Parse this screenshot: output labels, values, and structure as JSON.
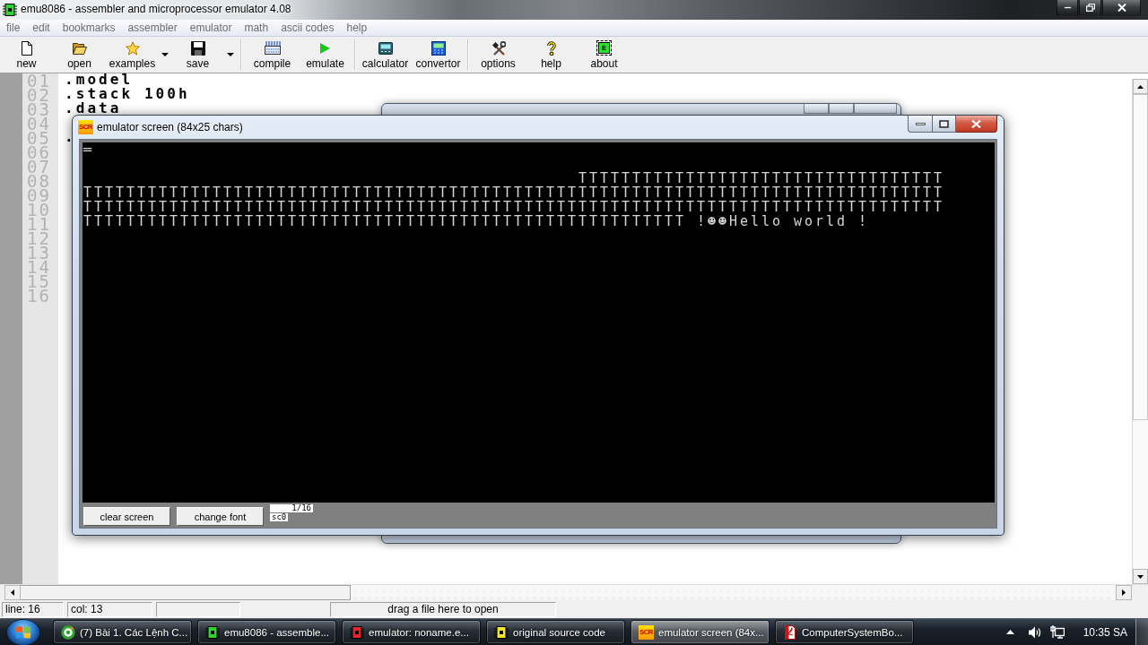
{
  "main_window": {
    "title": "emu8086 - assembler and microprocessor emulator 4.08",
    "menu": [
      "file",
      "edit",
      "bookmarks",
      "assembler",
      "emulator",
      "math",
      "ascii codes",
      "help"
    ],
    "toolbar": [
      [
        {
          "label": "new",
          "dropdown": false
        },
        {
          "label": "open",
          "dropdown": false
        },
        {
          "label": "examples",
          "dropdown": true
        },
        {
          "label": "save",
          "dropdown": true
        }
      ],
      [
        {
          "label": "compile",
          "dropdown": false
        },
        {
          "label": "emulate",
          "dropdown": false
        }
      ],
      [
        {
          "label": "calculator",
          "dropdown": false
        },
        {
          "label": "convertor",
          "dropdown": false
        }
      ],
      [
        {
          "label": "options",
          "dropdown": false
        },
        {
          "label": "help",
          "dropdown": false
        },
        {
          "label": "about",
          "dropdown": false,
          "icon_label": "E"
        }
      ]
    ],
    "editor": {
      "lines": [
        {
          "number": "01",
          "text": ".model"
        },
        {
          "number": "02",
          "text": ".stack 100h"
        },
        {
          "number": "03",
          "text": ".data"
        },
        {
          "number": "04"
        },
        {
          "number": "05",
          "text": "."
        },
        {
          "number": "06"
        },
        {
          "number": "07"
        },
        {
          "number": "08"
        },
        {
          "number": "09"
        },
        {
          "number": "10"
        },
        {
          "number": "11"
        },
        {
          "number": "12"
        },
        {
          "number": "13"
        },
        {
          "number": "14"
        },
        {
          "number": "15"
        },
        {
          "number": "16"
        }
      ]
    },
    "status_bar": {
      "line": "line: 16",
      "column": "col: 13",
      "hint": "drag a file here to open"
    }
  },
  "emulator_screen": {
    "title": "emulator screen (84x25 chars)",
    "icon_label": "SCR",
    "output": "═\n\n                                              TTTTTTTTTTTTTTTTTTTTTTTTTTTTTTTTTT\nTTTTTTTTTTTTTTTTTTTTTTTTTTTTTTTTTTTTTTTTTTTTTTTTTTTTTTTTTTTTTTTTTTTTTTTTTTTTTTTT\nTTTTTTTTTTTTTTTTTTTTTTTTTTTTTTTTTTTTTTTTTTTTTTTTTTTTTTTTTTTTTTTTTTTTTTTTTTTTTTTT\nTTTTTTTTTTTTTTTTTTTTTTTTTTTTTTTTTTTTTTTTTTTTTTTTTTTTTTTT !☻☻Hello world !",
    "buttons": [
      "clear screen",
      "change font"
    ],
    "page": "1/16",
    "font_label": "sc0"
  },
  "taskbar": {
    "items": [
      {
        "label": "(7) Bài 1. Các Lệnh C...",
        "selected": false
      },
      {
        "label": "emu8086 - assemble...",
        "selected": false
      },
      {
        "label": "emulator: noname.e...",
        "selected": false
      },
      {
        "label": "original source code",
        "selected": false
      },
      {
        "label": "emulator screen (84x...",
        "selected": true,
        "icon_label": "SCR"
      },
      {
        "label": "ComputerSystemBo...",
        "selected": false
      }
    ],
    "clock": "10:35 SA"
  }
}
